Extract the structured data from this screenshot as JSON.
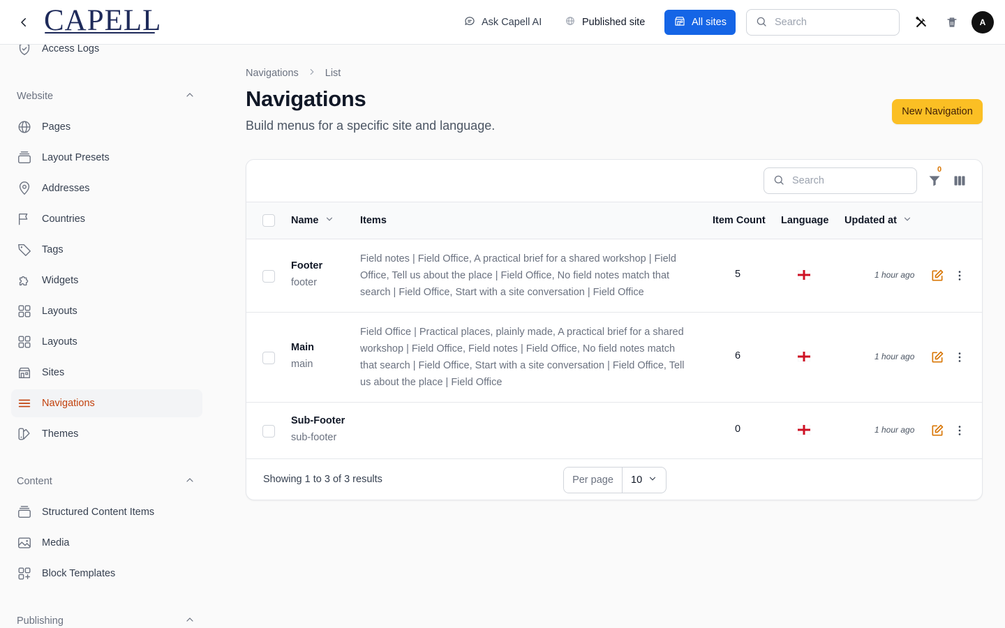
{
  "header": {
    "logo_text": "CAPELL",
    "ask_ai_label": "Ask Capell AI",
    "published_site_label": "Published site",
    "all_sites_label": "All sites",
    "search_placeholder": "Search",
    "avatar_initial": "A"
  },
  "sidebar": {
    "top_item": "Access Logs",
    "groups": [
      {
        "label": "Website",
        "items": [
          "Pages",
          "Layout Presets",
          "Addresses",
          "Countries",
          "Tags",
          "Widgets",
          "Layouts",
          "Layouts",
          "Sites",
          "Navigations",
          "Themes"
        ]
      },
      {
        "label": "Content",
        "items": [
          "Structured Content Items",
          "Media",
          "Block Templates"
        ]
      },
      {
        "label": "Publishing",
        "items": []
      }
    ],
    "active_item": "Navigations"
  },
  "breadcrumb": [
    "Navigations",
    "List"
  ],
  "page": {
    "title": "Navigations",
    "subtitle": "Build menus for a specific site and language.",
    "new_button": "New Navigation"
  },
  "table": {
    "search_placeholder": "Search",
    "filter_count": "0",
    "columns": {
      "name": "Name",
      "items": "Items",
      "item_count": "Item Count",
      "language": "Language",
      "updated_at": "Updated at"
    },
    "rows": [
      {
        "name": "Footer",
        "slug": "footer",
        "items": "Field notes | Field Office, A practical brief for a shared workshop | Field Office, Tell us about the place | Field Office, No field notes match that search | Field Office, Start with a site conversation | Field Office",
        "item_count": "5",
        "language": "england-flag",
        "updated": "1 hour ago"
      },
      {
        "name": "Main",
        "slug": "main",
        "items": "Field Office | Practical places, plainly made, A practical brief for a shared workshop | Field Office, Field notes | Field Office, No field notes match that search | Field Office, Start with a site conversation | Field Office, Tell us about the place | Field Office",
        "item_count": "6",
        "language": "england-flag",
        "updated": "1 hour ago"
      },
      {
        "name": "Sub-Footer",
        "slug": "sub-footer",
        "items": "",
        "item_count": "0",
        "language": "england-flag",
        "updated": "1 hour ago"
      }
    ],
    "footer_text": "Showing 1 to 3 of 3 results",
    "per_page_label": "Per page",
    "per_page_value": "10"
  },
  "colors": {
    "primary_blue": "#1565e6",
    "accent_amber": "#fbbf24",
    "active_nav": "#c2410c",
    "edit_icon": "#d97706"
  }
}
